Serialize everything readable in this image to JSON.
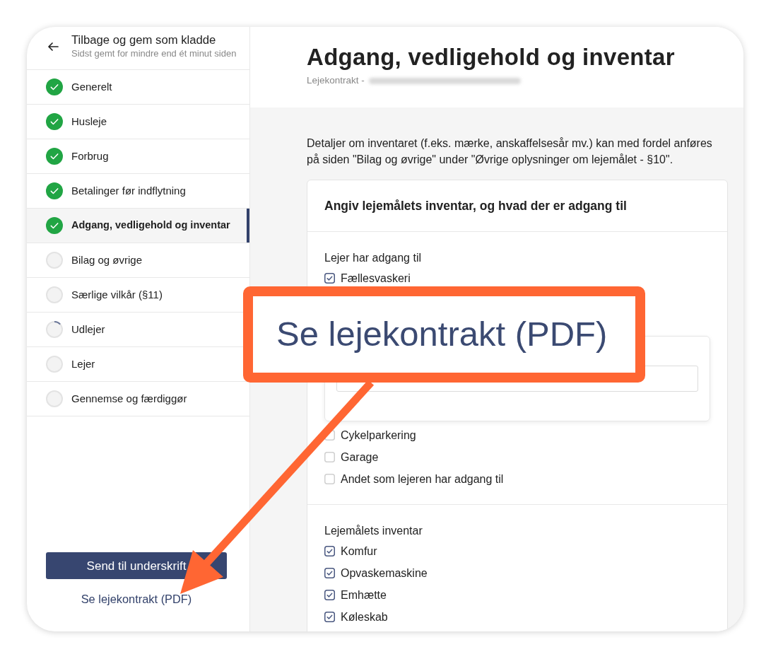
{
  "sidebar": {
    "back_title": "Tilbage og gem som kladde",
    "back_subtitle": "Sidst gemt for mindre end ét minut siden",
    "steps": [
      {
        "label": "Generelt",
        "kind": "done",
        "selected": false
      },
      {
        "label": "Husleje",
        "kind": "done",
        "selected": false
      },
      {
        "label": "Forbrug",
        "kind": "done",
        "selected": false
      },
      {
        "label": "Betalinger før indflytning",
        "kind": "done",
        "selected": false
      },
      {
        "label": "Adgang, vedligehold og inventar",
        "kind": "done",
        "selected": true
      },
      {
        "label": "Bilag og øvrige",
        "kind": "pending",
        "selected": false
      },
      {
        "label": "Særlige vilkår (§11)",
        "kind": "pending",
        "selected": false
      },
      {
        "label": "Udlejer",
        "kind": "partial",
        "selected": false
      },
      {
        "label": "Lejer",
        "kind": "pending",
        "selected": false
      },
      {
        "label": "Gennemse og færdiggør",
        "kind": "pending",
        "selected": false
      }
    ],
    "primary_button": "Send til underskrift",
    "pdf_link": "Se lejekontrakt (PDF)"
  },
  "header": {
    "title": "Adgang, vedligehold og inventar",
    "subtitle": "Lejekontrakt -",
    "redacted": true
  },
  "intro": "Detaljer om inventaret (f.eks. mærke, anskaffelsesår mv.) kan med fordel anføres på siden \"Bilag og øvrige\" under \"Øvrige oplysninger om lejemålet - §10\".",
  "card": {
    "title": "Angiv lejemålets inventar, og hvad der er adgang til",
    "sections": [
      {
        "label": "Lejer har adgang til",
        "items": [
          {
            "kind": "checkbox",
            "label": "Fællesvaskeri",
            "checked": true
          },
          {
            "kind": "input_panel"
          },
          {
            "kind": "checkbox",
            "label": "Cykelparkering",
            "checked": false
          },
          {
            "kind": "checkbox",
            "label": "Garage",
            "checked": false
          },
          {
            "kind": "checkbox",
            "label": "Andet som lejeren har adgang til",
            "checked": false
          }
        ]
      },
      {
        "label": "Lejemålets inventar",
        "items": [
          {
            "kind": "checkbox",
            "label": "Komfur",
            "checked": true
          },
          {
            "kind": "checkbox",
            "label": "Opvaskemaskine",
            "checked": true
          },
          {
            "kind": "checkbox",
            "label": "Emhætte",
            "checked": true
          },
          {
            "kind": "checkbox",
            "label": "Køleskab",
            "checked": true
          }
        ]
      }
    ]
  },
  "callout": {
    "text": "Se lejekontrakt (PDF)"
  }
}
